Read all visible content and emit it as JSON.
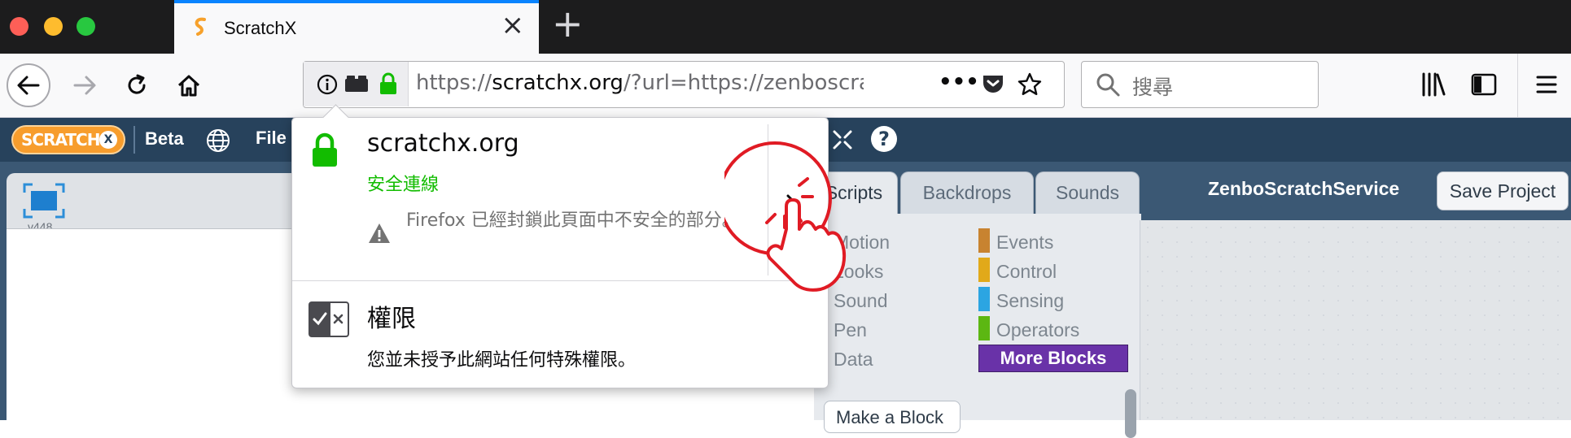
{
  "browser": {
    "tab": {
      "title": "ScratchX"
    },
    "url": {
      "prefix": "https://",
      "host": "scratchx.org",
      "rest": "/?url=https://zenboscrat"
    },
    "search": {
      "placeholder": "搜尋"
    },
    "colors": {
      "accent": "#0a84ff",
      "secure_green": "#12bc00"
    }
  },
  "scratch": {
    "logo": {
      "text": "SCRATCH",
      "badge": "X"
    },
    "beta_label": "Beta",
    "file_menu": "File",
    "stage": {
      "version": "v448"
    },
    "tabs": [
      "Scripts",
      "Backdrops",
      "Sounds"
    ],
    "project_name": "ZenboScratchService",
    "save_label": "Save Project",
    "categories_left": [
      "Motion",
      "Looks",
      "Sound",
      "Pen",
      "Data"
    ],
    "categories_right": [
      {
        "label": "Events",
        "color": "#c88330"
      },
      {
        "label": "Control",
        "color": "#e1a91a"
      },
      {
        "label": "Sensing",
        "color": "#2ca5e2"
      },
      {
        "label": "Operators",
        "color": "#5cb712"
      }
    ],
    "more_blocks": {
      "label": "More Blocks",
      "color": "#6932a8"
    },
    "make_block": "Make a Block"
  },
  "popup": {
    "host": "scratchx.org",
    "secure_text": "安全連線",
    "warning": "Firefox 已經封鎖此頁面中不安全的部分。",
    "permissions_title": "權限",
    "permissions_desc": "您並未授予此網站任何特殊權限。"
  }
}
